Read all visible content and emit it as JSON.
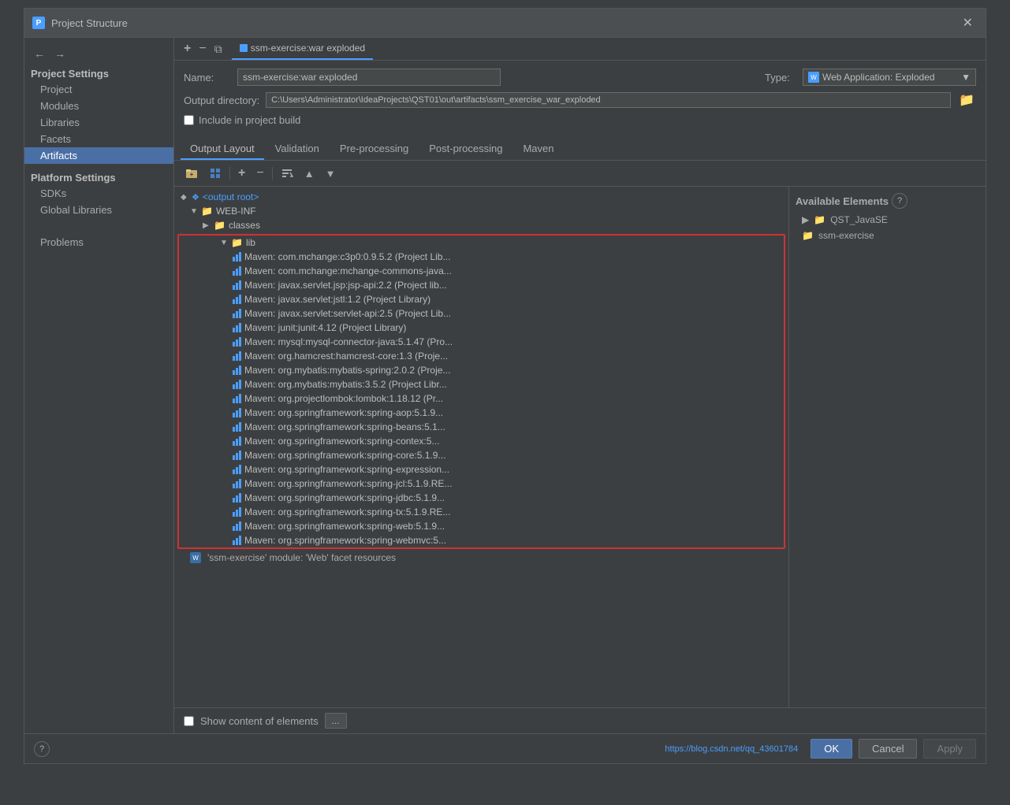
{
  "dialog": {
    "title": "Project Structure",
    "close_label": "✕"
  },
  "sidebar": {
    "nav_back": "←",
    "nav_forward": "→",
    "project_settings_header": "Project Settings",
    "items": [
      {
        "id": "project",
        "label": "Project"
      },
      {
        "id": "modules",
        "label": "Modules"
      },
      {
        "id": "libraries",
        "label": "Libraries"
      },
      {
        "id": "facets",
        "label": "Facets"
      },
      {
        "id": "artifacts",
        "label": "Artifacts",
        "active": true
      }
    ],
    "platform_settings_header": "Platform Settings",
    "platform_items": [
      {
        "id": "sdks",
        "label": "SDKs"
      },
      {
        "id": "global-libraries",
        "label": "Global Libraries"
      }
    ],
    "problems_label": "Problems"
  },
  "artifact": {
    "tab_label": "ssm-exercise:war exploded",
    "name_label": "Name:",
    "name_value": "ssm-exercise:war exploded",
    "type_label": "Type:",
    "type_value": "Web Application: Exploded",
    "output_dir_label": "Output directory:",
    "output_dir_value": "C:\\Users\\Administrator\\IdeaProjects\\QST01\\out\\artifacts\\ssm_exercise_war_exploded",
    "include_in_build_label": "Include in project build"
  },
  "tabs": {
    "output_layout": "Output Layout",
    "validation": "Validation",
    "pre_processing": "Pre-processing",
    "post_processing": "Post-processing",
    "maven": "Maven"
  },
  "output_tree": {
    "root": "<output root>",
    "web_inf": "WEB-INF",
    "classes": "classes",
    "lib": "lib",
    "maven_entries": [
      "Maven: com.mchange:c3p0:0.9.5.2 (Project Lib...",
      "Maven: com.mchange:mchange-commons-java...",
      "Maven: javax.servlet.jsp:jsp-api:2.2 (Project lib...",
      "Maven: javax.servlet:jstl:1.2 (Project Library)",
      "Maven: javax.servlet:servlet-api:2.5 (Project Lib...",
      "Maven: junit:junit:4.12 (Project Library)",
      "Maven: mysql:mysql-connector-java:5.1.47 (Pro...",
      "Maven: org.hamcrest:hamcrest-core:1.3 (Proje...",
      "Maven: org.mybatis:mybatis-spring:2.0.2 (Proje...",
      "Maven: org.mybatis:mybatis:3.5.2 (Project Libr...",
      "Maven: org.projectlombok:lombok:1.18.12 (Pr...",
      "Maven: org.springframework:spring-aop:5.1.9...",
      "Maven: org.springframework:spring-beans:5.1...",
      "Maven: org.springframework:spring-contex:5...",
      "Maven: org.springframework:spring-core:5.1.9...",
      "Maven: org.springframework:spring-expression...",
      "Maven: org.springframework:spring-jcl:5.1.9.RE...",
      "Maven: org.springframework:spring-jdbc:5.1.9...",
      "Maven: org.springframework:spring-tx:5.1.9.RE...",
      "Maven: org.springframework:spring-web:5.1.9...",
      "Maven: org.springframework:spring-webmvc:5..."
    ],
    "web_module_entry": "'ssm-exercise' module: 'Web' facet resources"
  },
  "available": {
    "header": "Available Elements",
    "help_icon": "?",
    "items": [
      {
        "label": "QST_JavaSE",
        "type": "folder"
      },
      {
        "label": "ssm-exercise",
        "type": "folder"
      }
    ]
  },
  "bottom": {
    "show_content_label": "Show content of elements",
    "dots_label": "..."
  },
  "dialog_footer": {
    "help_label": "?",
    "ok_label": "OK",
    "cancel_label": "Cancel",
    "apply_label": "Apply",
    "status_url": "https://blog.csdn.net/qq_43601784"
  }
}
